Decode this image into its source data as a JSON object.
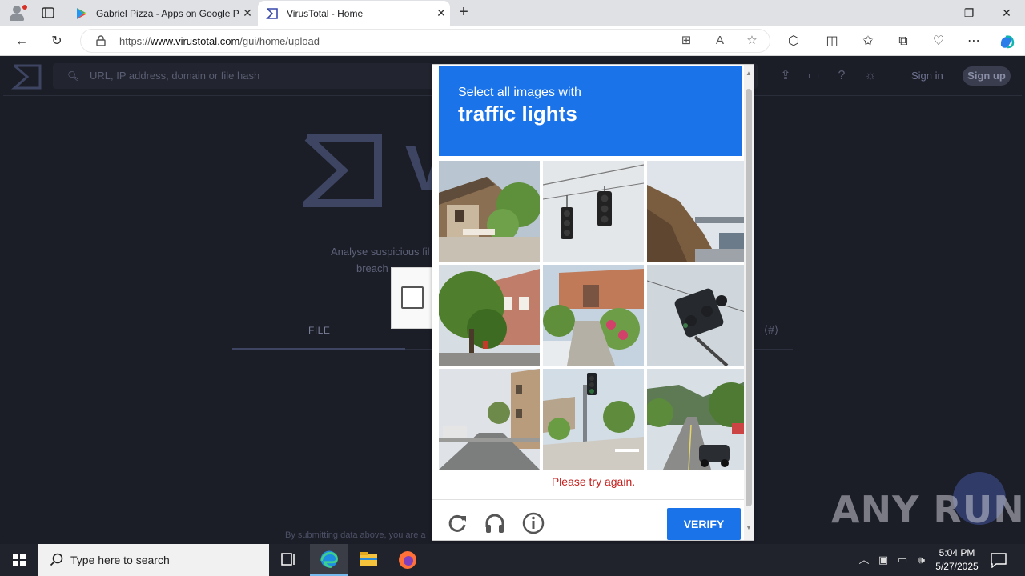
{
  "browser": {
    "tabs": [
      {
        "title": "Gabriel Pizza - Apps on Google P",
        "active": false
      },
      {
        "title": "VirusTotal - Home",
        "active": true
      }
    ],
    "url_prefix": "https://",
    "url_domain": "www.virustotal.com",
    "url_path": "/gui/home/upload"
  },
  "virustotal": {
    "search_placeholder": "URL, IP address, domain or file hash",
    "sign_in": "Sign in",
    "sign_up": "Sign up",
    "logo_letter": "V",
    "tagline_1": "Analyse suspicious fil",
    "tagline_2": "breach",
    "file_tab": "FILE",
    "submit_note": "By submitting data above, you are a"
  },
  "captcha": {
    "instruction": "Select all images with",
    "target": "traffic lights",
    "error": "Please try again.",
    "verify": "VERIFY",
    "tiles": [
      {
        "name": "house-tile"
      },
      {
        "name": "traffic-light-tile"
      },
      {
        "name": "bridge-tile"
      },
      {
        "name": "tree-street-tile"
      },
      {
        "name": "garden-house-tile"
      },
      {
        "name": "signal-closeup-tile"
      },
      {
        "name": "town-street-tile"
      },
      {
        "name": "crosswalk-signal-tile"
      },
      {
        "name": "highway-tile"
      }
    ]
  },
  "watermark": "ANY RUN",
  "taskbar": {
    "search_placeholder": "Type here to search",
    "time": "5:04 PM",
    "date": "5/27/2025"
  }
}
